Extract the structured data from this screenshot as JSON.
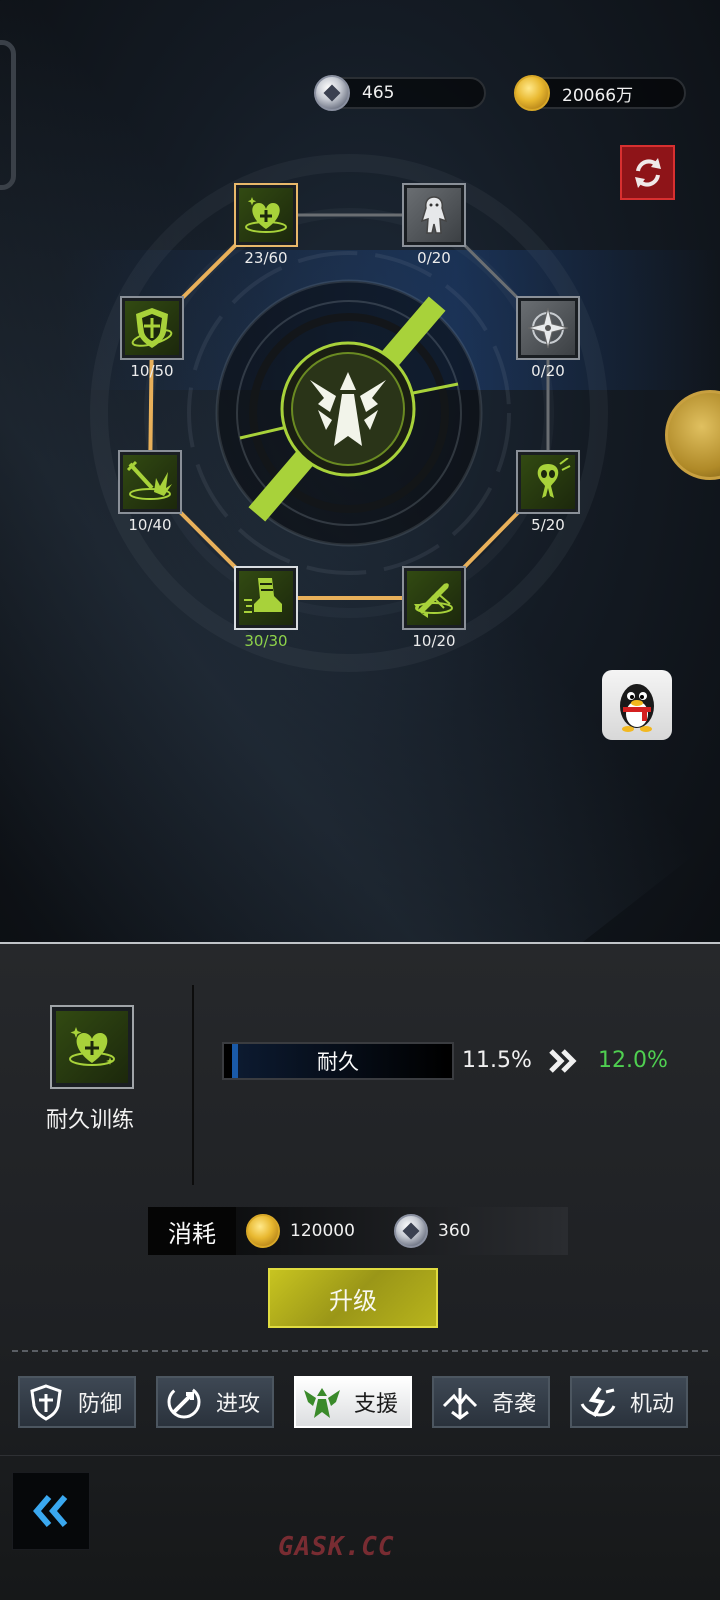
{
  "resources": {
    "silver_amount": "465",
    "gold_amount": "20066万"
  },
  "skill_tree": {
    "nodes": [
      {
        "id": "endurance",
        "count": "23/60",
        "state": "selected",
        "icon": "heart-plus-icon"
      },
      {
        "id": "locked-figure",
        "count": "0/20",
        "state": "locked",
        "icon": "figure-icon"
      },
      {
        "id": "compass",
        "count": "0/20",
        "state": "locked",
        "icon": "compass-star-icon"
      },
      {
        "id": "alien",
        "count": "5/20",
        "state": "active",
        "icon": "alien-icon"
      },
      {
        "id": "missile",
        "count": "10/20",
        "state": "active",
        "icon": "missile-icon"
      },
      {
        "id": "boot",
        "count": "30/30",
        "state": "maxed",
        "icon": "boot-icon"
      },
      {
        "id": "sword",
        "count": "10/40",
        "state": "active",
        "icon": "sword-burst-icon"
      },
      {
        "id": "shield",
        "count": "10/50",
        "state": "active",
        "icon": "shield-icon"
      }
    ]
  },
  "detail": {
    "skill_name": "耐久训练",
    "stat_name": "耐久",
    "current_value": "11.5%",
    "next_value": "12.0%"
  },
  "cost": {
    "label": "消耗",
    "gold": "120000",
    "silver": "360"
  },
  "upgrade_label": "升级",
  "tabs": [
    {
      "label": "防御",
      "icon": "shield-tab-icon",
      "active": false
    },
    {
      "label": "进攻",
      "icon": "attack-tab-icon",
      "active": false
    },
    {
      "label": "支援",
      "icon": "support-tab-icon",
      "active": true
    },
    {
      "label": "奇袭",
      "icon": "raid-tab-icon",
      "active": false
    },
    {
      "label": "机动",
      "icon": "mobility-tab-icon",
      "active": false
    }
  ],
  "watermark": "GASK.CC",
  "colors": {
    "accent_green": "#a8d23a",
    "link_orange": "#e8b05a",
    "positive_value": "#4fcf50",
    "upgrade_button": "#b8b41c",
    "refresh_red": "#8e1418"
  }
}
